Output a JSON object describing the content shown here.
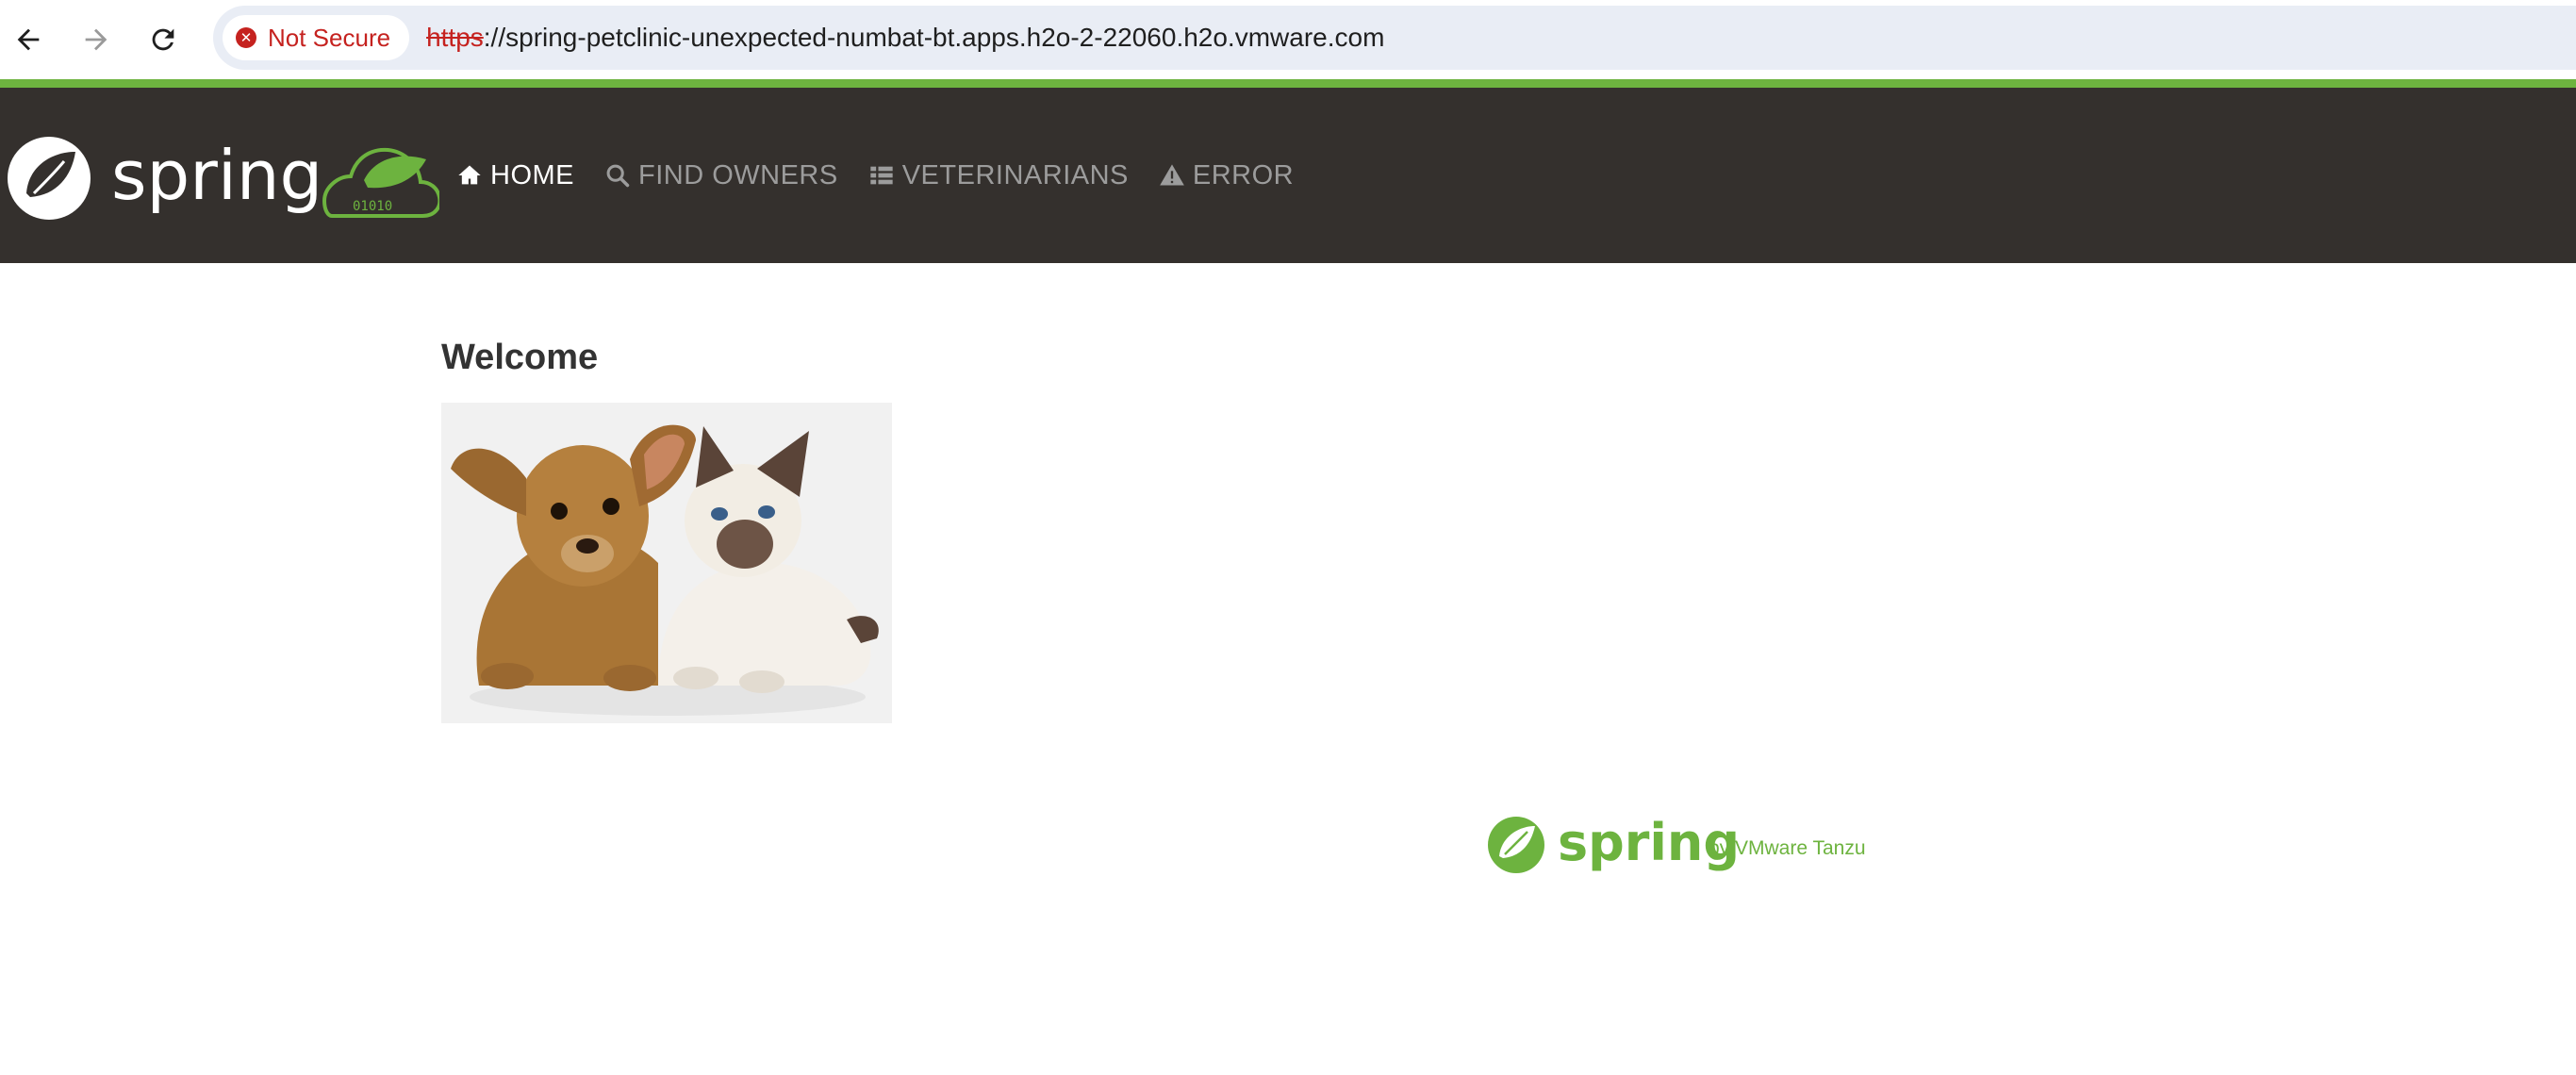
{
  "browser": {
    "security_label": "Not Secure",
    "url_scheme": "https",
    "url_rest": "://spring-petclinic-unexpected-numbat-bt.apps.h2o-2-22060.h2o.vmware.com",
    "icons": [
      "back-arrow-icon",
      "forward-arrow-icon",
      "reload-icon",
      "not-secure-icon"
    ]
  },
  "header": {
    "brand_text": "spring",
    "brand_badge_text": "01010",
    "nav": [
      {
        "label": "HOME",
        "icon": "home-icon"
      },
      {
        "label": "FIND OWNERS",
        "icon": "search-icon"
      },
      {
        "label": "VETERINARIANS",
        "icon": "list-icon"
      },
      {
        "label": "ERROR",
        "icon": "warning-icon"
      }
    ]
  },
  "main": {
    "title": "Welcome",
    "image_alt": "pets"
  },
  "footer": {
    "brand_text": "spring",
    "tagline": "by VMware Tanzu"
  },
  "colors": {
    "accent": "#6db33f",
    "navbar": "#34302d",
    "warning": "#c5221f"
  }
}
